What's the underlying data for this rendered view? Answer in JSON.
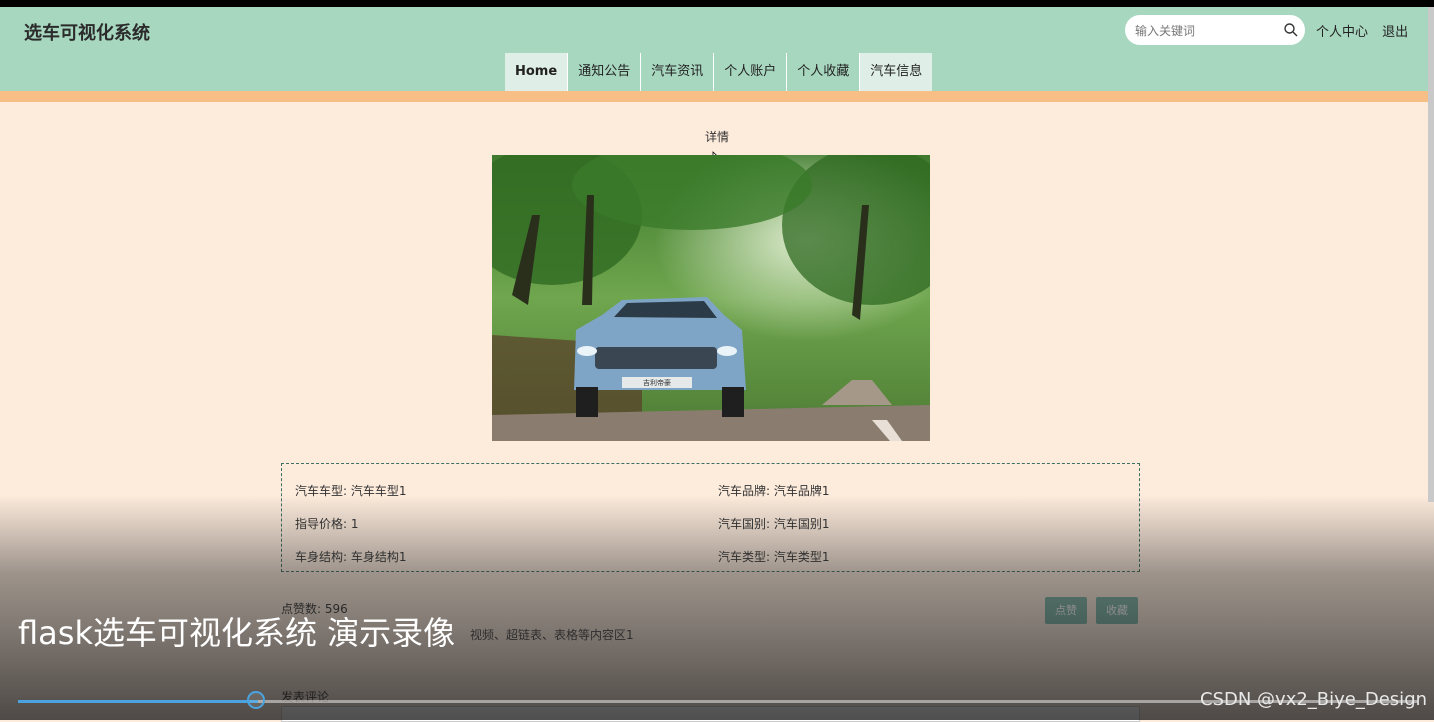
{
  "header": {
    "logo": "选车可视化系统",
    "search_placeholder": "输入关键词",
    "user_center": "个人中心",
    "logout": "退出"
  },
  "nav": {
    "items": [
      {
        "label": "Home"
      },
      {
        "label": "通知公告"
      },
      {
        "label": "汽车资讯"
      },
      {
        "label": "个人账户"
      },
      {
        "label": "个人收藏"
      },
      {
        "label": "汽车信息"
      }
    ]
  },
  "page": {
    "title": "详情",
    "car_plate_text": "吉利帝豪"
  },
  "info": {
    "model": "汽车车型: 汽车车型1",
    "brand": "汽车品牌: 汽车品牌1",
    "price": "指导价格: 1",
    "country": "汽车国别: 汽车国别1",
    "body": "车身结构: 车身结构1",
    "type": "汽车类型: 汽车类型1"
  },
  "likes": "点赞数: 596",
  "content_text": "视频、超链表、表格等内容区1",
  "buttons": {
    "like": "点赞",
    "collect": "收藏"
  },
  "comment": {
    "label": "发表评论"
  },
  "video": {
    "title": "flask选车可视化系统 演示录像",
    "progress": 0.17,
    "watermark": "CSDN @vx2_Biye_Design"
  }
}
